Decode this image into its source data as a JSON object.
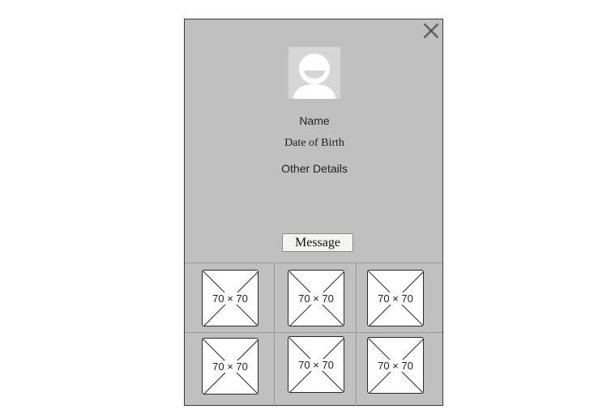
{
  "profile": {
    "name_label": "Name",
    "dob_label": "Date of Birth",
    "other_label": "Other Details",
    "message_button": "Message"
  },
  "icons": {
    "close": "close-icon",
    "avatar": "user-avatar-placeholder"
  },
  "colors": {
    "card_background": "#c0c0c0",
    "avatar_background": "#d6d6d6",
    "button_background": "#f4f4f2"
  },
  "thumbnails": [
    {
      "label": "70 × 70"
    },
    {
      "label": "70 × 70"
    },
    {
      "label": "70 × 70"
    },
    {
      "label": "70 × 70"
    },
    {
      "label": "70 × 70"
    },
    {
      "label": "70 × 70"
    }
  ]
}
